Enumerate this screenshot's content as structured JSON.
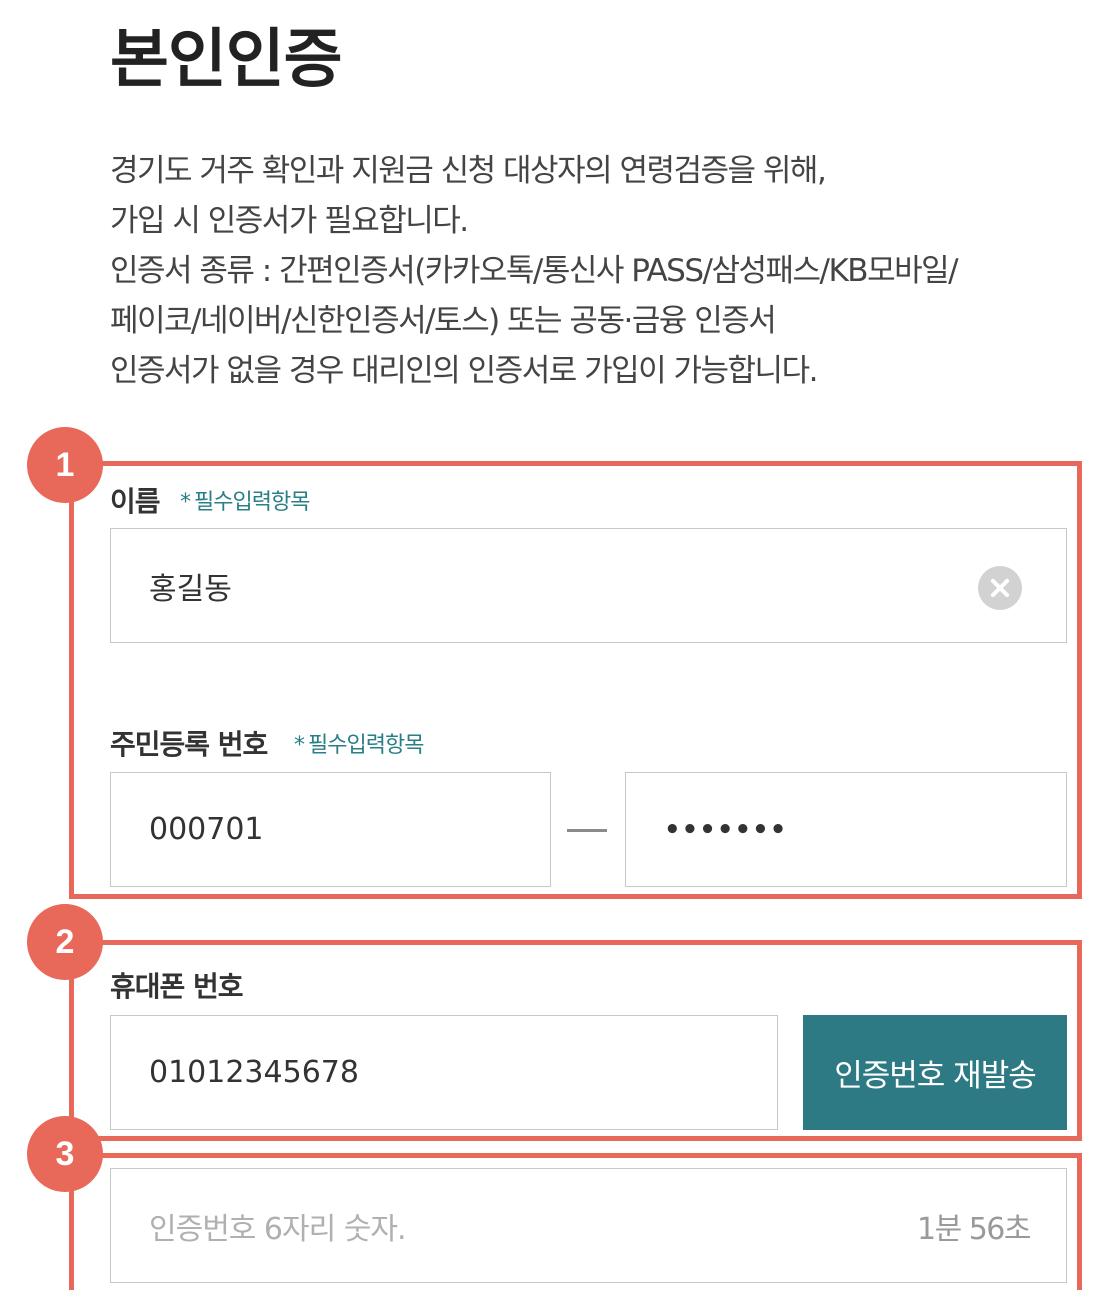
{
  "page": {
    "title": "본인인증",
    "description": [
      "경기도 거주 확인과 지원금 신청 대상자의 연령검증을 위해,",
      "가입 시 인증서가 필요합니다.",
      "인증서 종류 : 간편인증서(카카오톡/통신사 PASS/삼성패스/KB모바일/",
      "페이코/네이버/신한인증서/토스) 또는 공동·금융 인증서",
      "인증서가 없을 경우 대리인의 인증서로 가입이 가능합니다."
    ]
  },
  "steps": {
    "step1": "1",
    "step2": "2",
    "step3": "3"
  },
  "name_field": {
    "label": "이름",
    "required_star": "*",
    "required_text": "필수입력항목",
    "value": "홍길동",
    "clear_icon": "clear-circle-icon"
  },
  "rrn_field": {
    "label": "주민등록 번호",
    "required_star": "*",
    "required_text": "필수입력항목",
    "front_value": "000701",
    "back_value": "•••••••"
  },
  "phone_field": {
    "label": "휴대폰 번호",
    "value": "01012345678",
    "resend_button": "인증번호 재발송"
  },
  "code_field": {
    "placeholder": "인증번호 6자리 숫자.",
    "timer": "1분 56초"
  },
  "colors": {
    "highlight": "#e8685a",
    "accent": "#2d7a85",
    "required_text": "#2a7f86"
  }
}
